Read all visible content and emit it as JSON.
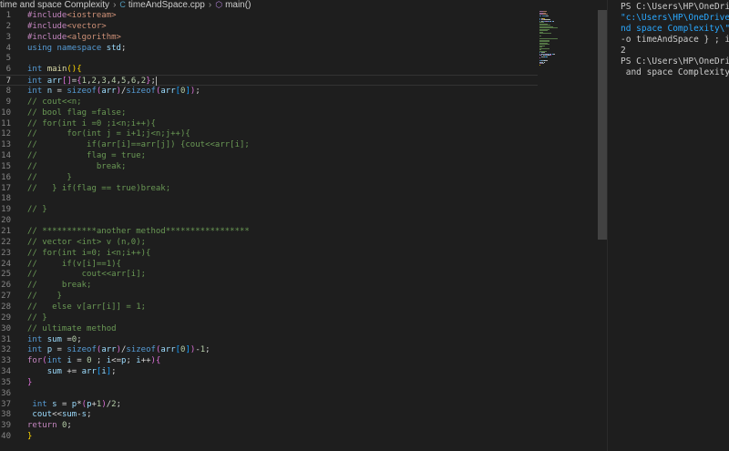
{
  "breadcrumb": {
    "folder": "time and space Complexity",
    "file_icon": "C",
    "file": "timeAndSpace.cpp",
    "symbol": "main()"
  },
  "terminal": {
    "lines": [
      "PS C:\\Users\\HP\\OneDrive\\",
      "\"c:\\Users\\HP\\OneDrive\\De",
      "nd space Complexity\\\" ;",
      "-o timeAndSpace } ; if (",
      "2",
      "PS C:\\Users\\HP\\OneDrive\\",
      " and space Complexity>"
    ]
  },
  "colors": {
    "editor_bg": "#1e1e1e",
    "keyword": "#569cd6",
    "comment": "#6a9955",
    "number": "#b5cea8",
    "string": "#ce9178",
    "function": "#dcdcaa",
    "variable": "#9cdcfe",
    "terminal_link": "#2aa8ff"
  },
  "editor": {
    "active_line": 7,
    "lines": [
      {
        "n": "1",
        "t": [
          [
            "pp",
            "#include"
          ],
          [
            "inc",
            "<iostream>"
          ]
        ]
      },
      {
        "n": "2",
        "t": [
          [
            "pp",
            "#include"
          ],
          [
            "inc",
            "<vector>"
          ]
        ]
      },
      {
        "n": "3",
        "t": [
          [
            "pp",
            "#include"
          ],
          [
            "inc",
            "<algorithm>"
          ]
        ]
      },
      {
        "n": "4",
        "t": [
          [
            "kw",
            "using"
          ],
          [
            "",
            "",
            " "
          ],
          [
            "kw",
            "namespace"
          ],
          [
            "",
            " "
          ],
          [
            "vr",
            "std"
          ],
          [
            "",
            ";"
          ]
        ]
      },
      {
        "n": "5",
        "t": []
      },
      {
        "n": "6",
        "t": [
          [
            "kw",
            "int"
          ],
          [
            "",
            " "
          ],
          [
            "fn",
            "main"
          ],
          [
            "br1",
            "()"
          ],
          [
            "br1",
            "{"
          ]
        ]
      },
      {
        "n": "7",
        "t": [
          [
            "kw",
            "int"
          ],
          [
            "",
            " "
          ],
          [
            "vr",
            "arr"
          ],
          [
            "br2",
            "[]"
          ],
          [
            "",
            "="
          ],
          [
            "br2",
            "{"
          ],
          [
            "nm",
            "1"
          ],
          [
            "",
            ","
          ],
          [
            "nm",
            "2"
          ],
          [
            "",
            ","
          ],
          [
            "nm",
            "3"
          ],
          [
            "",
            ","
          ],
          [
            "nm",
            "4"
          ],
          [
            "",
            ","
          ],
          [
            "nm",
            "5"
          ],
          [
            "",
            ","
          ],
          [
            "nm",
            "6"
          ],
          [
            "",
            ","
          ],
          [
            "nm",
            "2"
          ],
          [
            "br2",
            "}"
          ],
          [
            "",
            ";"
          ],
          [
            "cursor",
            ""
          ]
        ]
      },
      {
        "n": "8",
        "t": [
          [
            "kw",
            "int"
          ],
          [
            "",
            " "
          ],
          [
            "vr",
            "n"
          ],
          [
            "",
            " = "
          ],
          [
            "kw",
            "sizeof"
          ],
          [
            "br2",
            "("
          ],
          [
            "vr",
            "arr"
          ],
          [
            "br2",
            ")"
          ],
          [
            "",
            "/"
          ],
          [
            "kw",
            "sizeof"
          ],
          [
            "br2",
            "("
          ],
          [
            "vr",
            "arr"
          ],
          [
            "br3",
            "["
          ],
          [
            "nm",
            "0"
          ],
          [
            "br3",
            "]"
          ],
          [
            "br2",
            ")"
          ],
          [
            "",
            ";"
          ]
        ]
      },
      {
        "n": "9",
        "t": [
          [
            "cm",
            "// cout<<n;"
          ]
        ]
      },
      {
        "n": "10",
        "t": [
          [
            "cm",
            "// bool flag =false;"
          ]
        ]
      },
      {
        "n": "11",
        "t": [
          [
            "cm",
            "// for(int i =0 ;i<n;i++){"
          ]
        ]
      },
      {
        "n": "12",
        "t": [
          [
            "cm",
            "//      for(int j = i+1;j<n;j++){"
          ]
        ]
      },
      {
        "n": "13",
        "t": [
          [
            "cm",
            "//          if(arr[i]==arr[j]) {cout<<arr[i];"
          ]
        ]
      },
      {
        "n": "14",
        "t": [
          [
            "cm",
            "//          flag = true;"
          ]
        ]
      },
      {
        "n": "15",
        "t": [
          [
            "cm",
            "//            break;"
          ]
        ]
      },
      {
        "n": "16",
        "t": [
          [
            "cm",
            "//      }"
          ]
        ]
      },
      {
        "n": "17",
        "t": [
          [
            "cm",
            "//   } if(flag == true)break;"
          ]
        ]
      },
      {
        "n": "18",
        "t": []
      },
      {
        "n": "19",
        "t": [
          [
            "cm",
            "// }"
          ]
        ]
      },
      {
        "n": "20",
        "t": []
      },
      {
        "n": "21",
        "t": [
          [
            "cm",
            "// ***********another method*****************"
          ]
        ]
      },
      {
        "n": "22",
        "t": [
          [
            "cm",
            "// vector <int> v (n,0);"
          ]
        ]
      },
      {
        "n": "23",
        "t": [
          [
            "cm",
            "// for(int i=0; i<n;i++){"
          ]
        ]
      },
      {
        "n": "24",
        "t": [
          [
            "cm",
            "//     if(v[i]==1){"
          ]
        ]
      },
      {
        "n": "25",
        "t": [
          [
            "cm",
            "//         cout<<arr[i];"
          ]
        ]
      },
      {
        "n": "26",
        "t": [
          [
            "cm",
            "//     break;"
          ]
        ]
      },
      {
        "n": "27",
        "t": [
          [
            "cm",
            "//    }"
          ]
        ]
      },
      {
        "n": "28",
        "t": [
          [
            "cm",
            "//   else v[arr[i]] = 1;"
          ]
        ]
      },
      {
        "n": "29",
        "t": [
          [
            "cm",
            "// }"
          ]
        ]
      },
      {
        "n": "30",
        "t": [
          [
            "cm",
            "// ultimate method"
          ]
        ]
      },
      {
        "n": "31",
        "t": [
          [
            "kw",
            "int"
          ],
          [
            "",
            " "
          ],
          [
            "vr",
            "sum"
          ],
          [
            "",
            " ="
          ],
          [
            "nm",
            "0"
          ],
          [
            "",
            ";"
          ]
        ]
      },
      {
        "n": "32",
        "t": [
          [
            "kw",
            "int"
          ],
          [
            "",
            " "
          ],
          [
            "vr",
            "p"
          ],
          [
            "",
            " = "
          ],
          [
            "kw",
            "sizeof"
          ],
          [
            "br2",
            "("
          ],
          [
            "vr",
            "arr"
          ],
          [
            "br2",
            ")"
          ],
          [
            "",
            "/"
          ],
          [
            "kw",
            "sizeof"
          ],
          [
            "br2",
            "("
          ],
          [
            "vr",
            "arr"
          ],
          [
            "br3",
            "["
          ],
          [
            "nm",
            "0"
          ],
          [
            "br3",
            "]"
          ],
          [
            "br2",
            ")"
          ],
          [
            "",
            "-"
          ],
          [
            "nm",
            "1"
          ],
          [
            "",
            ";"
          ]
        ]
      },
      {
        "n": "33",
        "t": [
          [
            "ct",
            "for"
          ],
          [
            "br2",
            "("
          ],
          [
            "kw",
            "int"
          ],
          [
            "",
            " "
          ],
          [
            "vr",
            "i"
          ],
          [
            "",
            " = "
          ],
          [
            "nm",
            "0"
          ],
          [
            "",
            " ; "
          ],
          [
            "vr",
            "i"
          ],
          [
            "",
            "<="
          ],
          [
            "vr",
            "p"
          ],
          [
            "",
            "; "
          ],
          [
            "vr",
            "i"
          ],
          [
            "",
            "++"
          ],
          [
            "br2",
            ")"
          ],
          [
            "br2",
            "{"
          ]
        ]
      },
      {
        "n": "34",
        "t": [
          [
            "",
            "    "
          ],
          [
            "vr",
            "sum"
          ],
          [
            "",
            " += "
          ],
          [
            "vr",
            "arr"
          ],
          [
            "br3",
            "["
          ],
          [
            "vr",
            "i"
          ],
          [
            "br3",
            "]"
          ],
          [
            "",
            ";"
          ]
        ]
      },
      {
        "n": "35",
        "t": [
          [
            "br2",
            "}"
          ]
        ]
      },
      {
        "n": "36",
        "t": []
      },
      {
        "n": "37",
        "t": [
          [
            "",
            "",
            " "
          ],
          [
            "kw",
            "int"
          ],
          [
            "",
            " "
          ],
          [
            "vr",
            "s"
          ],
          [
            "",
            " = "
          ],
          [
            "vr",
            "p"
          ],
          [
            "",
            "*"
          ],
          [
            "br2",
            "("
          ],
          [
            "vr",
            "p"
          ],
          [
            "",
            "+"
          ],
          [
            "nm",
            "1"
          ],
          [
            "br2",
            ")"
          ],
          [
            "",
            "/"
          ],
          [
            "nm",
            "2"
          ],
          [
            "",
            ";"
          ]
        ]
      },
      {
        "n": "38",
        "t": [
          [
            "",
            "",
            " "
          ],
          [
            "vr",
            "cout"
          ],
          [
            "",
            "<<"
          ],
          [
            "vr",
            "sum"
          ],
          [
            "",
            "-"
          ],
          [
            "vr",
            "s"
          ],
          [
            "",
            ";"
          ]
        ]
      },
      {
        "n": "39",
        "t": [
          [
            "ct",
            "return"
          ],
          [
            "",
            " "
          ],
          [
            "nm",
            "0"
          ],
          [
            "",
            ";"
          ]
        ]
      },
      {
        "n": "40",
        "t": [
          [
            "br1",
            "}"
          ]
        ]
      }
    ]
  }
}
